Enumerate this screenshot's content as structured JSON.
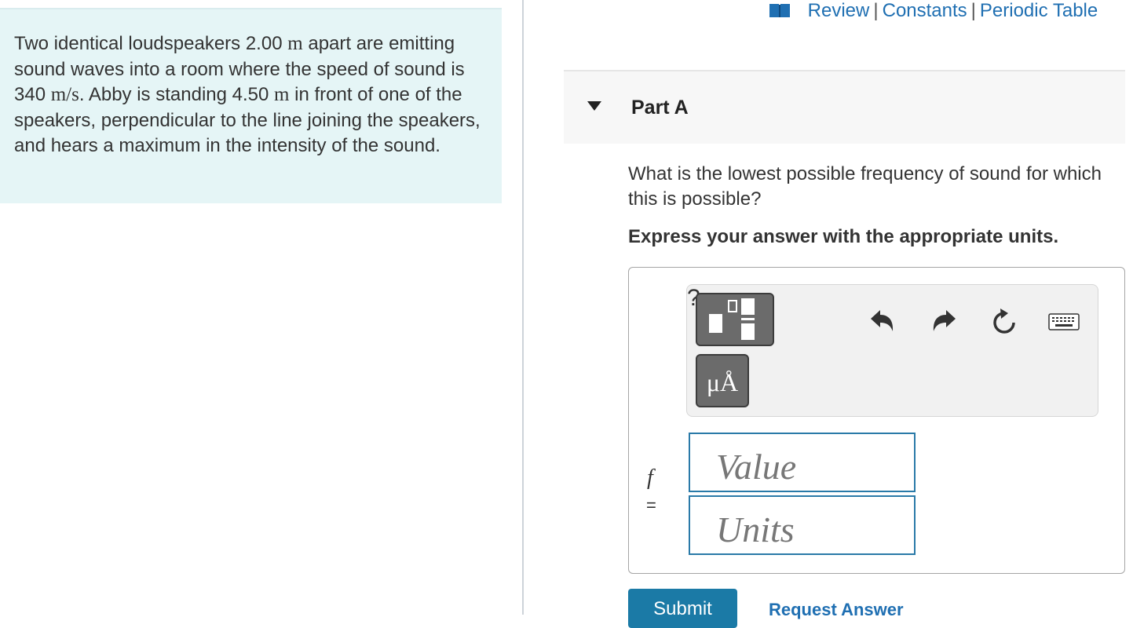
{
  "problem": {
    "segments": [
      {
        "t": "Two identical loudspeakers 2.00 ",
        "m": false
      },
      {
        "t": "m",
        "m": true
      },
      {
        "t": " apart are emitting sound waves into a room where the speed of sound is 340 ",
        "m": false
      },
      {
        "t": "m/s",
        "m": true
      },
      {
        "t": ". Abby is standing 4.50 ",
        "m": false
      },
      {
        "t": "m",
        "m": true
      },
      {
        "t": " in front of one of the speakers, perpendicular to the line joining the speakers, and hears a maximum in the intensity of the sound.",
        "m": false
      }
    ]
  },
  "toplinks": {
    "review": "Review",
    "constants": "Constants",
    "periodic_table": "Periodic Table",
    "separator": "|"
  },
  "part": {
    "title": "Part A",
    "question": "What is the lowest possible frequency of sound for which this is possible?",
    "instruction": "Express your answer with the appropriate units."
  },
  "toolbar": {
    "units_button_label": "μÅ",
    "help_label": "?",
    "icons": [
      "templates-icon",
      "units-icon",
      "undo-icon",
      "redo-icon",
      "reset-icon",
      "keyboard-icon"
    ]
  },
  "answer": {
    "variable": "f",
    "equals": "=",
    "value_placeholder": "Value",
    "units_placeholder": "Units"
  },
  "actions": {
    "submit": "Submit",
    "request_answer": "Request Answer"
  },
  "colors": {
    "problem_bg": "#e5f5f6",
    "link": "#1f6fb2",
    "submit_bg": "#1b7aa6",
    "field_border": "#2a7aa8",
    "button_dark": "#6b6b6b"
  }
}
